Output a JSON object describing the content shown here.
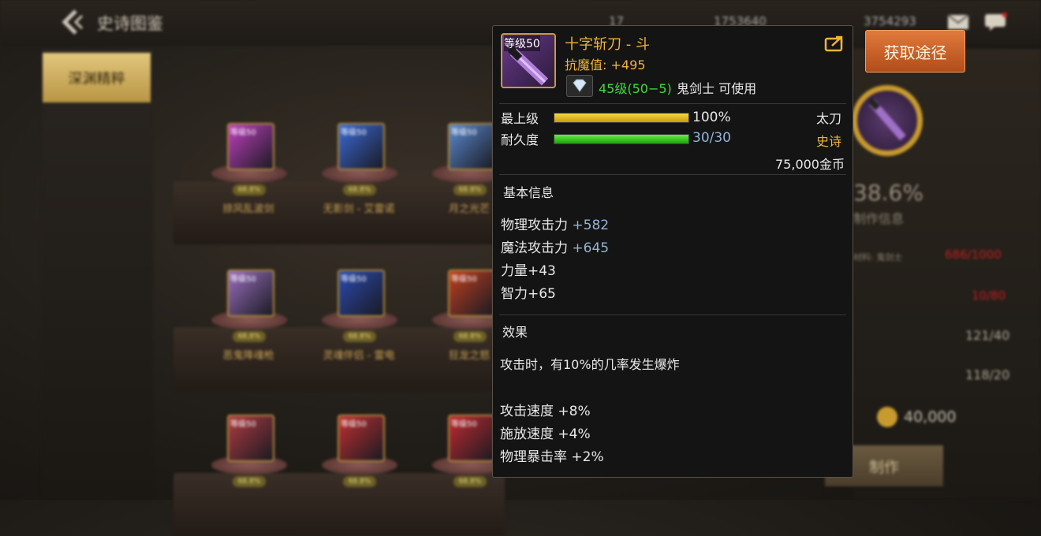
{
  "header": {
    "title": "史诗图鉴",
    "resources": [
      "17",
      "1753640",
      "3754293"
    ]
  },
  "sidebar": {
    "active_tab": "深渊精粹"
  },
  "grid": {
    "level_label": "等级50",
    "badge": "68.8%",
    "items": [
      {
        "name": "掠风乱波剑",
        "color": "#c040c0"
      },
      {
        "name": "无影剑 - 艾雷诺",
        "color": "#3a6ad8"
      },
      {
        "name": "月之光芒",
        "color": "#5a8ad0"
      },
      {
        "name": "恶鬼降魂枪",
        "color": "#9a70c0"
      },
      {
        "name": "灵魂伴侣 - 雷电",
        "color": "#2a4ab0"
      },
      {
        "name": "狂龙之怒",
        "color": "#c04020"
      },
      {
        "name": "",
        "color": "#b03a40"
      },
      {
        "name": "",
        "color": "#c03030"
      },
      {
        "name": "",
        "color": "#c02a30"
      }
    ]
  },
  "right_panel": {
    "obtain_button": "获取途径",
    "percent": "38.6%",
    "craft_info": "制作信息",
    "req1_label": "材料: 鬼剑士",
    "req1_value": "686/1000",
    "req2_value": "10/80",
    "req3_value": "121/40",
    "req4_value": "118/20",
    "cost": "40,000",
    "craft_button": "制作"
  },
  "popup": {
    "icon_level": "等级50",
    "item_name": "十字斩刀 - 斗",
    "anti_magic": "抗魔值: +495",
    "req_level": "45级(50−5)",
    "req_class": "鬼剑士 可使用",
    "grade_label": "最上级",
    "grade_value": "100%",
    "grade_percent": 100,
    "durability_label": "耐久度",
    "durability_value": "30/30",
    "durability_percent": 100,
    "weapon_type": "太刀",
    "rarity": "史诗",
    "price": "75,000金币",
    "basic_section": "基本信息",
    "stats": [
      {
        "label": "物理攻击力 ",
        "value": "+582"
      },
      {
        "label": "魔法攻击力 ",
        "value": "+645"
      },
      {
        "label": "力量+43",
        "value": ""
      },
      {
        "label": "智力+65",
        "value": ""
      }
    ],
    "effect_section": "效果",
    "effect_text": "攻击时，有10%的几率发生爆炸",
    "bonuses": [
      "攻击速度 +8%",
      "施放速度 +4%",
      "物理暴击率 +2%"
    ],
    "colors": {
      "name": "#f0b33a",
      "grade_bar": "#e8c020",
      "durability_bar": "#40d020",
      "rarity": "#f0b33a"
    }
  }
}
